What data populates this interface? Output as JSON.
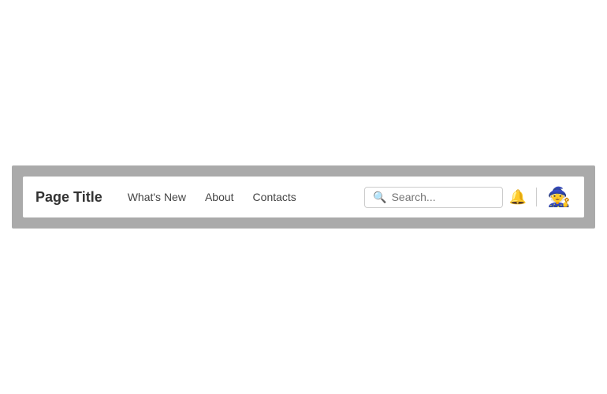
{
  "navbar": {
    "brand": "Page Title",
    "links": [
      {
        "label": "What's New",
        "id": "whats-new"
      },
      {
        "label": "About",
        "id": "about"
      },
      {
        "label": "Contacts",
        "id": "contacts"
      }
    ],
    "search": {
      "placeholder": "Search..."
    },
    "bell_icon": "🔔",
    "avatar_icon": "🧙"
  }
}
